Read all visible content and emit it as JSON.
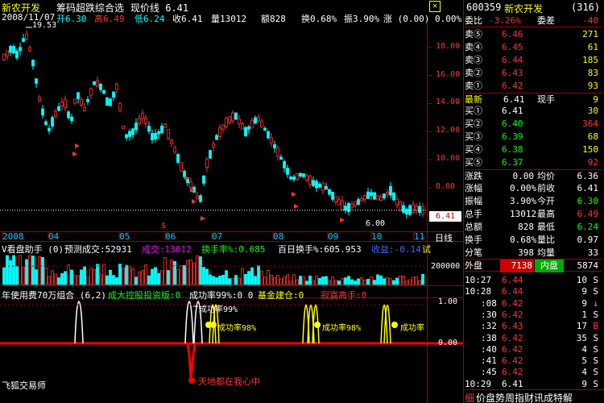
{
  "app": {
    "title": "新农开发",
    "indicator_name": "筹码超跌综合选",
    "price_line_label": "现价线 6.41"
  },
  "header": {
    "date": "2008/11/07",
    "open": "开6.30",
    "high": "高6.49",
    "low": "低6.24",
    "close": "收6.41",
    "volume": "量13012",
    "amount": "额828",
    "amplitude_change": "换0.68%",
    "swing": "振3.90%",
    "change": "涨 (0.00) 0.00%"
  },
  "main_chart": {
    "y_ticks": [
      "18.00",
      "16.00",
      "14.00",
      "12.00",
      "10.00",
      "8.00"
    ],
    "high_label": "19.53",
    "low_label": "6.00",
    "current_price_tag": "6.41",
    "x_labels": [
      "2008",
      "04",
      "05",
      "06",
      "07",
      "08",
      "09",
      "10",
      "11"
    ],
    "period_button": "日线",
    "marker_dollar": "$"
  },
  "sub1": {
    "title": "V看盘助手 (0)",
    "predicted": "预测成交:52931",
    "volume": "成交:13012",
    "turnover": "换手率%:0.685",
    "hundred_day": "百日换手%:605.953",
    "income": "收益:-0.14",
    "extra": "试",
    "y_label": "200000",
    "colors": {
      "predicted": "#ffffff",
      "volume": "#ff00ff",
      "turnover": "#00ff00",
      "hundred": "#ffffff",
      "income": "#4444ff"
    }
  },
  "sub2": {
    "title": "年使用费70万组合 (6,2)",
    "f1": "成大控股投资版:0",
    "f2": "成功率99%:0 0",
    "f3": "基金建仓:0",
    "f4": "寂寞高手:0",
    "y_top": "1.00",
    "y_mid": "0.00",
    "ann_rate_99": "成功率99%",
    "ann_rate_98_a": "成功率98%",
    "ann_rate_98_b": "成功率98%",
    "ann_rate_tail": "成功率",
    "ann_heaven": "天地都在我心中",
    "footer_label": "飞狐交易师"
  },
  "quote": {
    "code": "600359",
    "name": "新农开发",
    "count": "(316)",
    "webi_label": "委比",
    "webi_val": "-3.26%",
    "weicha_label": "委差",
    "weicha_val": "-40",
    "asks": [
      {
        "label": "卖⑤",
        "price": "6.46",
        "vol": "271"
      },
      {
        "label": "卖④",
        "price": "6.45",
        "vol": "61"
      },
      {
        "label": "卖③",
        "price": "6.44",
        "vol": "185"
      },
      {
        "label": "卖②",
        "price": "6.43",
        "vol": "83"
      },
      {
        "label": "卖①",
        "price": "6.42",
        "vol": "93"
      }
    ],
    "latest_label": "最新",
    "latest_price": "6.41",
    "now_hand_label": "现手",
    "now_hand_val": "9",
    "bids": [
      {
        "label": "买①",
        "price": "6.41",
        "vol": "30"
      },
      {
        "label": "买②",
        "price": "6.40",
        "vol": "364"
      },
      {
        "label": "买③",
        "price": "6.39",
        "vol": "68"
      },
      {
        "label": "买④",
        "price": "6.38",
        "vol": "150"
      },
      {
        "label": "买⑤",
        "price": "6.37",
        "vol": "92"
      }
    ],
    "stats": [
      {
        "l1": "涨跌",
        "v1": "0.00",
        "l2": "均价",
        "v2": "6.36"
      },
      {
        "l1": "涨幅",
        "v1": "0.00%",
        "l2": "前收",
        "v2": "6.41"
      },
      {
        "l1": "振幅",
        "v1": "3.90%",
        "l2": "今开",
        "v2": "6.30"
      },
      {
        "l1": "总手",
        "v1": "13012",
        "l2": "最高",
        "v2": "6.49"
      },
      {
        "l1": "总额",
        "v1": "828",
        "l2": "最低",
        "v2": "6.24"
      },
      {
        "l1": "换手",
        "v1": "0.68%",
        "l2": "量比",
        "v2": "0.97"
      },
      {
        "l1": "分笔",
        "v1": "398",
        "l2": "均量",
        "v2": "33"
      }
    ],
    "outer_label": "外盘",
    "outer_val": "7138",
    "inner_label": "内盘",
    "inner_val": "5874"
  },
  "ticks": [
    {
      "time": "10:27",
      "price": "6.44",
      "vol": "10",
      "flag": "S"
    },
    {
      "time": "10:28",
      "price": "6.44",
      "vol": "9",
      "flag": "S"
    },
    {
      "time": ":08",
      "price": "6.42",
      "vol": "9",
      "flag": "↓"
    },
    {
      "time": ":30",
      "price": "6.42",
      "vol": "1",
      "flag": "S"
    },
    {
      "time": ":32",
      "price": "6.43",
      "vol": "17",
      "flag": "B"
    },
    {
      "time": ":38",
      "price": "6.42",
      "vol": "35",
      "flag": "S"
    },
    {
      "time": ":40",
      "price": "6.42",
      "vol": "4",
      "flag": "S"
    },
    {
      "time": ":41",
      "price": "6.42",
      "vol": "5",
      "flag": "S"
    },
    {
      "time": ":45",
      "price": "6.42",
      "vol": "4",
      "flag": "S"
    },
    {
      "time": "10:29",
      "price": "6.41",
      "vol": "9",
      "flag": "S"
    }
  ],
  "bottom_tabs": {
    "detail": "细",
    "items": "价盘势周指财讯成特解"
  },
  "close_icon": "✕"
}
